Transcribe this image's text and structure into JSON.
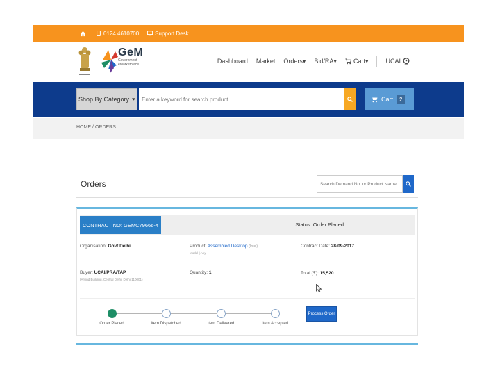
{
  "topbar": {
    "phone": "0124 4610700",
    "support": "Support Desk"
  },
  "header": {
    "emblem_caption": "सत्यमेव जयते",
    "logo_big": "GeM",
    "logo_line1": "Government",
    "logo_line2": "eMarketplace",
    "nav": {
      "dashboard": "Dashboard",
      "market": "Market",
      "orders": "Orders▾",
      "bidra": "Bid/RA▾",
      "cart": "Cart▾",
      "user": "UCAI"
    }
  },
  "search_band": {
    "category_label": "Shop By Category",
    "search_placeholder": "Enter a keyword for search product",
    "cart_label": "Cart",
    "cart_count": "2"
  },
  "breadcrumb": {
    "home": "HOME",
    "sep": "/",
    "current": "ORDERS"
  },
  "orders": {
    "title": "Orders",
    "search_placeholder": "Search Demand No. or Product Name"
  },
  "order_card": {
    "contract_no": "CONTRACT NO: GEMC79666-4",
    "status": "Status: Order Placed",
    "organisation_label": "Organisation:",
    "organisation_value": "Govt Delhi",
    "product_label": "Product:",
    "product_value": "Assembled Desktop",
    "product_suffix": "(Intel)",
    "product_sub": "Model | Any",
    "contract_date_label": "Contract Date:",
    "contract_date_value": "28-09-2017",
    "buyer_label": "Buyer:",
    "buyer_value": "UCAI/PRA/TAP",
    "buyer_sub": "(Arvind Building, Central Delhi, Delhi-110001)",
    "quantity_label": "Quantity:",
    "quantity_value": "1",
    "total_label": "Total (₹):",
    "total_value": "15,520",
    "steps": [
      "Order Placed",
      "Item Dispatched",
      "Item Delivered",
      "Item Accepted"
    ],
    "process_button": "Process Order"
  },
  "colors": {
    "orange": "#f7931e",
    "navy": "#0d3b8c",
    "blue": "#1f68c9",
    "green": "#1e8e66"
  }
}
